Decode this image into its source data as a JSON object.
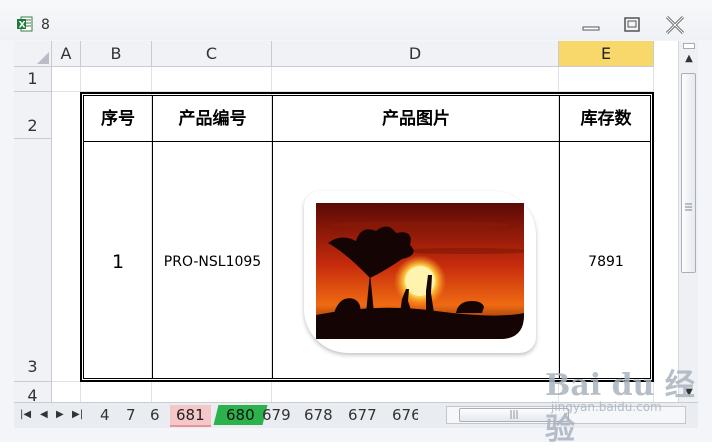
{
  "window": {
    "title": "8"
  },
  "columns": [
    "A",
    "B",
    "C",
    "D",
    "E"
  ],
  "selected_column": "E",
  "rows": [
    "1",
    "2",
    "3",
    "4"
  ],
  "table": {
    "headers": [
      "序号",
      "产品编号",
      "产品图片",
      "库存数"
    ],
    "row": {
      "index": "1",
      "code": "PRO-NSL1095",
      "stock": "7891"
    }
  },
  "sheet_tabs": [
    "4",
    "7",
    "6",
    "681",
    "680",
    "679",
    "678",
    "677",
    "676"
  ],
  "active_tab": "680",
  "icons": {
    "app": "excel-icon",
    "minimize": "minimize-icon",
    "restore": "restore-icon",
    "close": "close-icon",
    "image": "sunset-safari-photo"
  },
  "colors": {
    "selected_header": "#f8d86b",
    "active_tab": "#2bb24c",
    "highlight_tab": "#f5c7c9"
  },
  "watermark": {
    "logo": "Bai du 经验",
    "url": "jingyan.baidu.com"
  }
}
